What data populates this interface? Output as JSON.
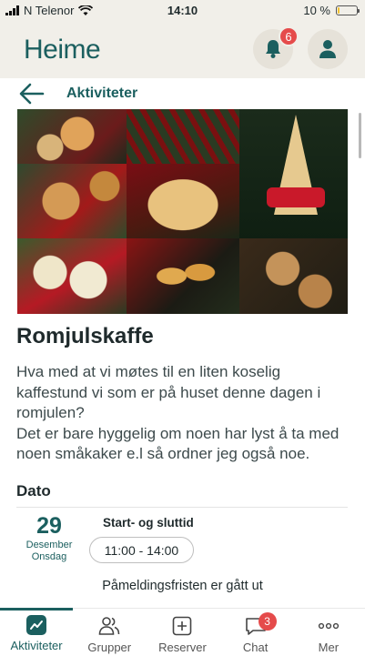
{
  "status_bar": {
    "carrier": "N Telenor",
    "time": "14:10",
    "battery_text": "10 %",
    "battery_level": 0.1
  },
  "header": {
    "logo": "Heime",
    "notification_count": "6",
    "icons": [
      "bell-icon",
      "profile-icon"
    ]
  },
  "nav": {
    "back_icon": "arrow-left-icon",
    "title": "Aktiviteter"
  },
  "event": {
    "title": "Romjulskaffe",
    "description": "Hva med at vi møtes til en liten koselig kaffestund vi som er på huset denne dagen i romjulen?\nDet er bare hyggelig om noen har lyst å ta med noen småkaker e.l så ordner jeg også noe.",
    "date_section_title": "Dato",
    "date": {
      "day": "29",
      "month": "Desember",
      "weekday": "Onsdag"
    },
    "time_label": "Start- og sluttid",
    "time_range": "11:00 - 14:00",
    "deadline_text": "Påmeldingsfristen er gått ut"
  },
  "tab_bar": {
    "tabs": [
      {
        "label": "Aktiviteter",
        "icon": "activity-chart-icon",
        "active": true
      },
      {
        "label": "Grupper",
        "icon": "group-icon",
        "active": false
      },
      {
        "label": "Reserver",
        "icon": "plus-square-icon",
        "active": false
      },
      {
        "label": "Chat",
        "icon": "chat-bubble-icon",
        "active": false,
        "badge": "3"
      },
      {
        "label": "Mer",
        "icon": "more-dots-icon",
        "active": false
      }
    ]
  },
  "colors": {
    "brand": "#1b5f5f",
    "badge": "#e54b4b",
    "header_bg": "#f1efe9"
  }
}
